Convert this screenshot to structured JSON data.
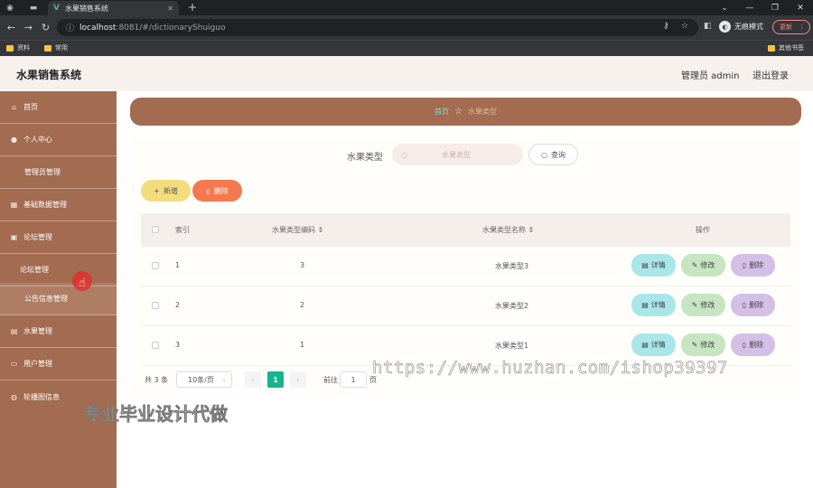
{
  "browser": {
    "tab_title": "水果销售系统",
    "url_host": "localhost",
    "url_path": ":8081/#/dictionaryShuiguo",
    "incognito_label": "无痕模式",
    "update_label": "更新",
    "bookmarks": [
      "资料",
      "常用",
      "其他书签"
    ]
  },
  "header": {
    "title": "水果销售系统",
    "user": "管理员 admin",
    "logout": "退出登录"
  },
  "sidebar": {
    "items": [
      {
        "label": "首页",
        "icon": "home-icon"
      },
      {
        "label": "个人中心",
        "icon": "user-icon"
      },
      {
        "label": "管理员管理",
        "icon": ""
      },
      {
        "label": "基础数据管理",
        "icon": "grid-icon"
      },
      {
        "label": "论坛管理",
        "icon": "chat-icon"
      },
      {
        "label": "论坛管理",
        "icon": ""
      },
      {
        "label": "公告信息管理",
        "icon": ""
      },
      {
        "label": "水果管理",
        "icon": "fruit-icon"
      },
      {
        "label": "用户管理",
        "icon": "users-icon"
      },
      {
        "label": "轮播图信息",
        "icon": "image-icon"
      }
    ]
  },
  "breadcrumb": {
    "home": "首页",
    "current": "水果类型"
  },
  "search": {
    "label": "水果类型",
    "placeholder": "水果类型",
    "query_button": "查询"
  },
  "actions": {
    "add": "新增",
    "delete": "删除"
  },
  "table": {
    "headers": [
      "索引",
      "水果类型编码",
      "水果类型名称",
      "操作"
    ],
    "rows": [
      {
        "index": "1",
        "code": "3",
        "name": "水果类型3"
      },
      {
        "index": "2",
        "code": "2",
        "name": "水果类型2"
      },
      {
        "index": "3",
        "code": "1",
        "name": "水果类型1"
      }
    ],
    "row_actions": {
      "detail": "详情",
      "edit": "修改",
      "delete": "删除"
    }
  },
  "pagination": {
    "total": "共 3 条",
    "page_size": "10条/页",
    "current_page": "1",
    "goto_label": "前往",
    "goto_value": "1",
    "page_suffix": "页"
  },
  "watermarks": {
    "url": "https://www.huzhan.com/ishop39397",
    "slogan": "专业毕业设计代做"
  },
  "colors": {
    "brand": "#a36b4f",
    "header_bg": "#f7f1ee",
    "add_button": "#f3dc7d",
    "delete_button": "#f5794e",
    "detail_button": "#a9e6ea",
    "edit_button": "#c7e5c2",
    "row_delete_button": "#d4bfe6",
    "page_active": "#19b48e"
  }
}
